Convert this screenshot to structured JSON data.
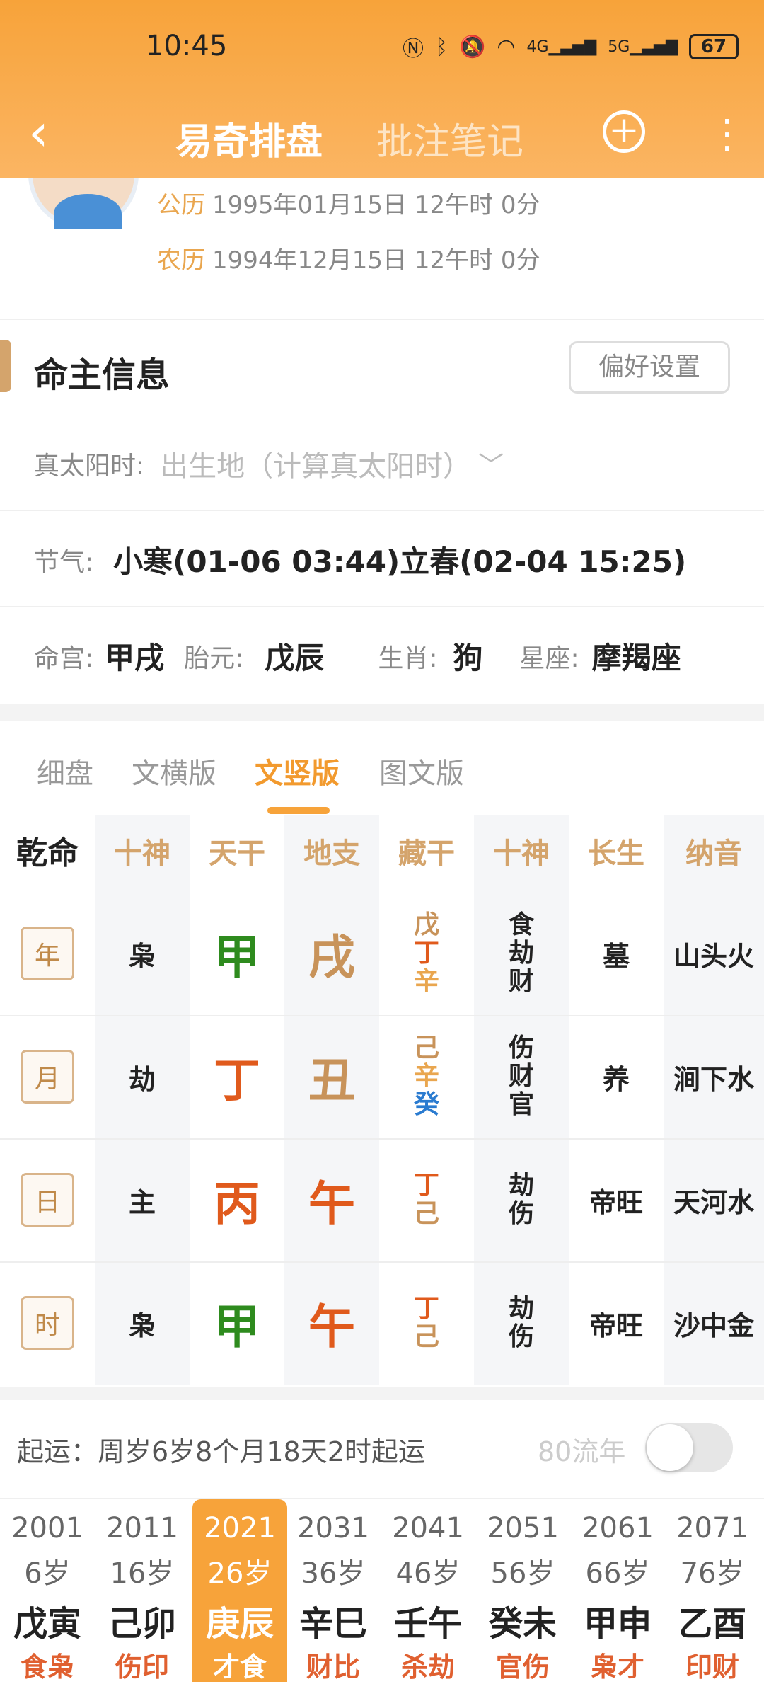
{
  "status": {
    "time": "10:45",
    "battery": "67",
    "icons": [
      "nfc-icon",
      "bluetooth-icon",
      "mute-icon",
      "wifi-icon",
      "4g-signal-icon",
      "5g-signal-icon"
    ]
  },
  "nav": {
    "active_tab": "易奇排盘",
    "inactive_tab": "批注笔记"
  },
  "birth": {
    "solar_label": "公历",
    "solar": "1995年01月15日 12午时 0分",
    "lunar_label": "农历",
    "lunar": "1994年12月15日 12午时 0分"
  },
  "section": {
    "title": "命主信息",
    "pref_button": "偏好设置"
  },
  "true_solar": {
    "label": "真太阳时:",
    "placeholder": "出生地（计算真太阳时）"
  },
  "jieqi": {
    "label": "节气:",
    "value": "小寒(01-06 03:44)立春(02-04 15:25)"
  },
  "misc": {
    "minggong_label": "命宫:",
    "minggong": "甲戌",
    "taiyuan_label": "胎元:",
    "taiyuan": "戊辰",
    "shengxiao_label": "生肖:",
    "shengxiao": "狗",
    "xingzuo_label": "星座:",
    "xingzuo": "摩羯座"
  },
  "view_tabs": [
    "细盘",
    "文横版",
    "文竖版",
    "图文版"
  ],
  "table": {
    "headers": [
      "乾命",
      "十神",
      "天干",
      "地支",
      "藏干",
      "十神",
      "长生",
      "纳音"
    ],
    "rows": [
      {
        "pillar": "年",
        "shishen": "枭",
        "gan": "甲",
        "zhi": "戌",
        "canggan": [
          "戊",
          "丁",
          "辛"
        ],
        "shishen2": [
          "食",
          "劫",
          "财"
        ],
        "changsheng": "墓",
        "nayin": "山头火"
      },
      {
        "pillar": "月",
        "shishen": "劫",
        "gan": "丁",
        "zhi": "丑",
        "canggan": [
          "己",
          "辛",
          "癸"
        ],
        "shishen2": [
          "伤",
          "财",
          "官"
        ],
        "changsheng": "养",
        "nayin": "涧下水"
      },
      {
        "pillar": "日",
        "shishen": "主",
        "gan": "丙",
        "zhi": "午",
        "canggan": [
          "丁",
          "己"
        ],
        "shishen2": [
          "劫",
          "伤"
        ],
        "changsheng": "帝旺",
        "nayin": "天河水"
      },
      {
        "pillar": "时",
        "shishen": "枭",
        "gan": "甲",
        "zhi": "午",
        "canggan": [
          "丁",
          "己"
        ],
        "shishen2": [
          "劫",
          "伤"
        ],
        "changsheng": "帝旺",
        "nayin": "沙中金"
      }
    ]
  },
  "colors": {
    "wood": "#2e8b1e",
    "fire": "#e05a1c",
    "earth": "#c8935a",
    "metal": "#e9a64f",
    "water": "#2a7bd0",
    "accent": "#f7a33a"
  },
  "qiyun": {
    "text": "起运：周岁6岁8个月18天2时起运",
    "liunian_label": "80流年",
    "liunian_on": false
  },
  "dayun": [
    {
      "year": "2001",
      "age": "6岁",
      "gz": "戊寅",
      "ss": "食枭"
    },
    {
      "year": "2011",
      "age": "16岁",
      "gz": "己卯",
      "ss": "伤印"
    },
    {
      "year": "2021",
      "age": "26岁",
      "gz": "庚辰",
      "ss": "才食"
    },
    {
      "year": "2031",
      "age": "36岁",
      "gz": "辛巳",
      "ss": "财比"
    },
    {
      "year": "2041",
      "age": "46岁",
      "gz": "壬午",
      "ss": "杀劫"
    },
    {
      "year": "2051",
      "age": "56岁",
      "gz": "癸未",
      "ss": "官伤"
    },
    {
      "year": "2061",
      "age": "66岁",
      "gz": "甲申",
      "ss": "枭才"
    },
    {
      "year": "2071",
      "age": "76岁",
      "gz": "乙酉",
      "ss": "印财"
    }
  ]
}
